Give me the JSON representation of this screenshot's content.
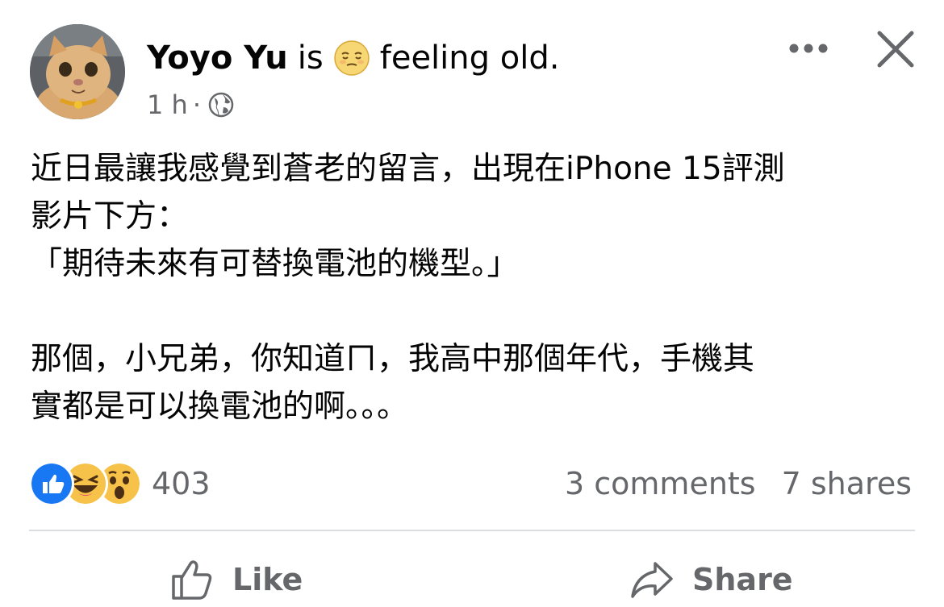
{
  "post": {
    "author": "Yoyo Yu",
    "is_word": "is",
    "feeling": "feeling old.",
    "time": "1 h",
    "separator": "·",
    "body_lines": [
      "近日最讓我感覺到蒼老的留言，出現在iPhone 15評測",
      "影片下方：",
      "「期待未來有可替換電池的機型。」",
      "",
      "那個，小兄弟，你知道ㄇ，我高中那個年代，手機其",
      "實都是可以換電池的啊。。。"
    ]
  },
  "stats": {
    "reaction_count": "403",
    "comments": "3 comments",
    "shares": "7 shares"
  },
  "actions": {
    "like_label": "Like",
    "share_label": "Share"
  },
  "colors": {
    "text": "#050505",
    "secondary": "#65676b",
    "like_blue": "#1877f2",
    "divider": "#dadde1"
  },
  "icons": [
    "avatar-cat",
    "pensive-face-icon",
    "globe-icon",
    "more-icon",
    "close-icon",
    "like-reaction-icon",
    "haha-reaction-icon",
    "wow-reaction-icon",
    "thumbs-up-icon",
    "share-arrow-icon"
  ]
}
